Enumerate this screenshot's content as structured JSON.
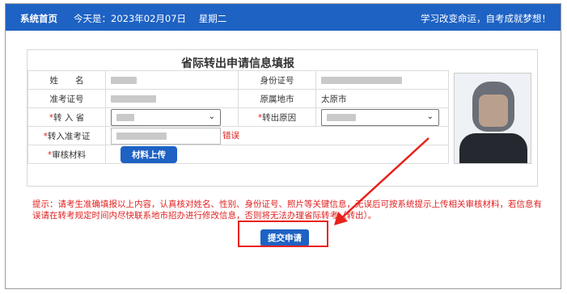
{
  "header": {
    "home_label": "系统首页",
    "today_label": "今天是：2023年02月07日",
    "weekday": "星期二",
    "slogan": "学习改变命运，自考成就梦想！"
  },
  "form": {
    "title": "省际转出申请信息填报",
    "name_label": "姓　　名",
    "idcard_label": "身份证号",
    "exam_id_label": "准考证号",
    "origin_city_label": "原属地市",
    "origin_city_value": "太原市",
    "to_province_label": "转 入 省",
    "transfer_reason_label": "转出原因",
    "new_exam_id_label": "转入准考证",
    "new_exam_id_error": "错误",
    "review_label": "审核材料",
    "upload_button": "材料上传",
    "required_mark": "*"
  },
  "notice": "提示：请考生准确填报以上内容，认真核对姓名、性别、身份证号、照片等关键信息，无误后可按系统提示上传相关审核材料，若信息有误请在转考规定时间内尽快联系地市招办进行修改信息，否则将无法办理省际转考（转出）。",
  "submit_button": "提交申请",
  "colors": {
    "brand_blue": "#1e62c4",
    "warning_red": "#e02020",
    "annotation_red": "#e8211b"
  }
}
